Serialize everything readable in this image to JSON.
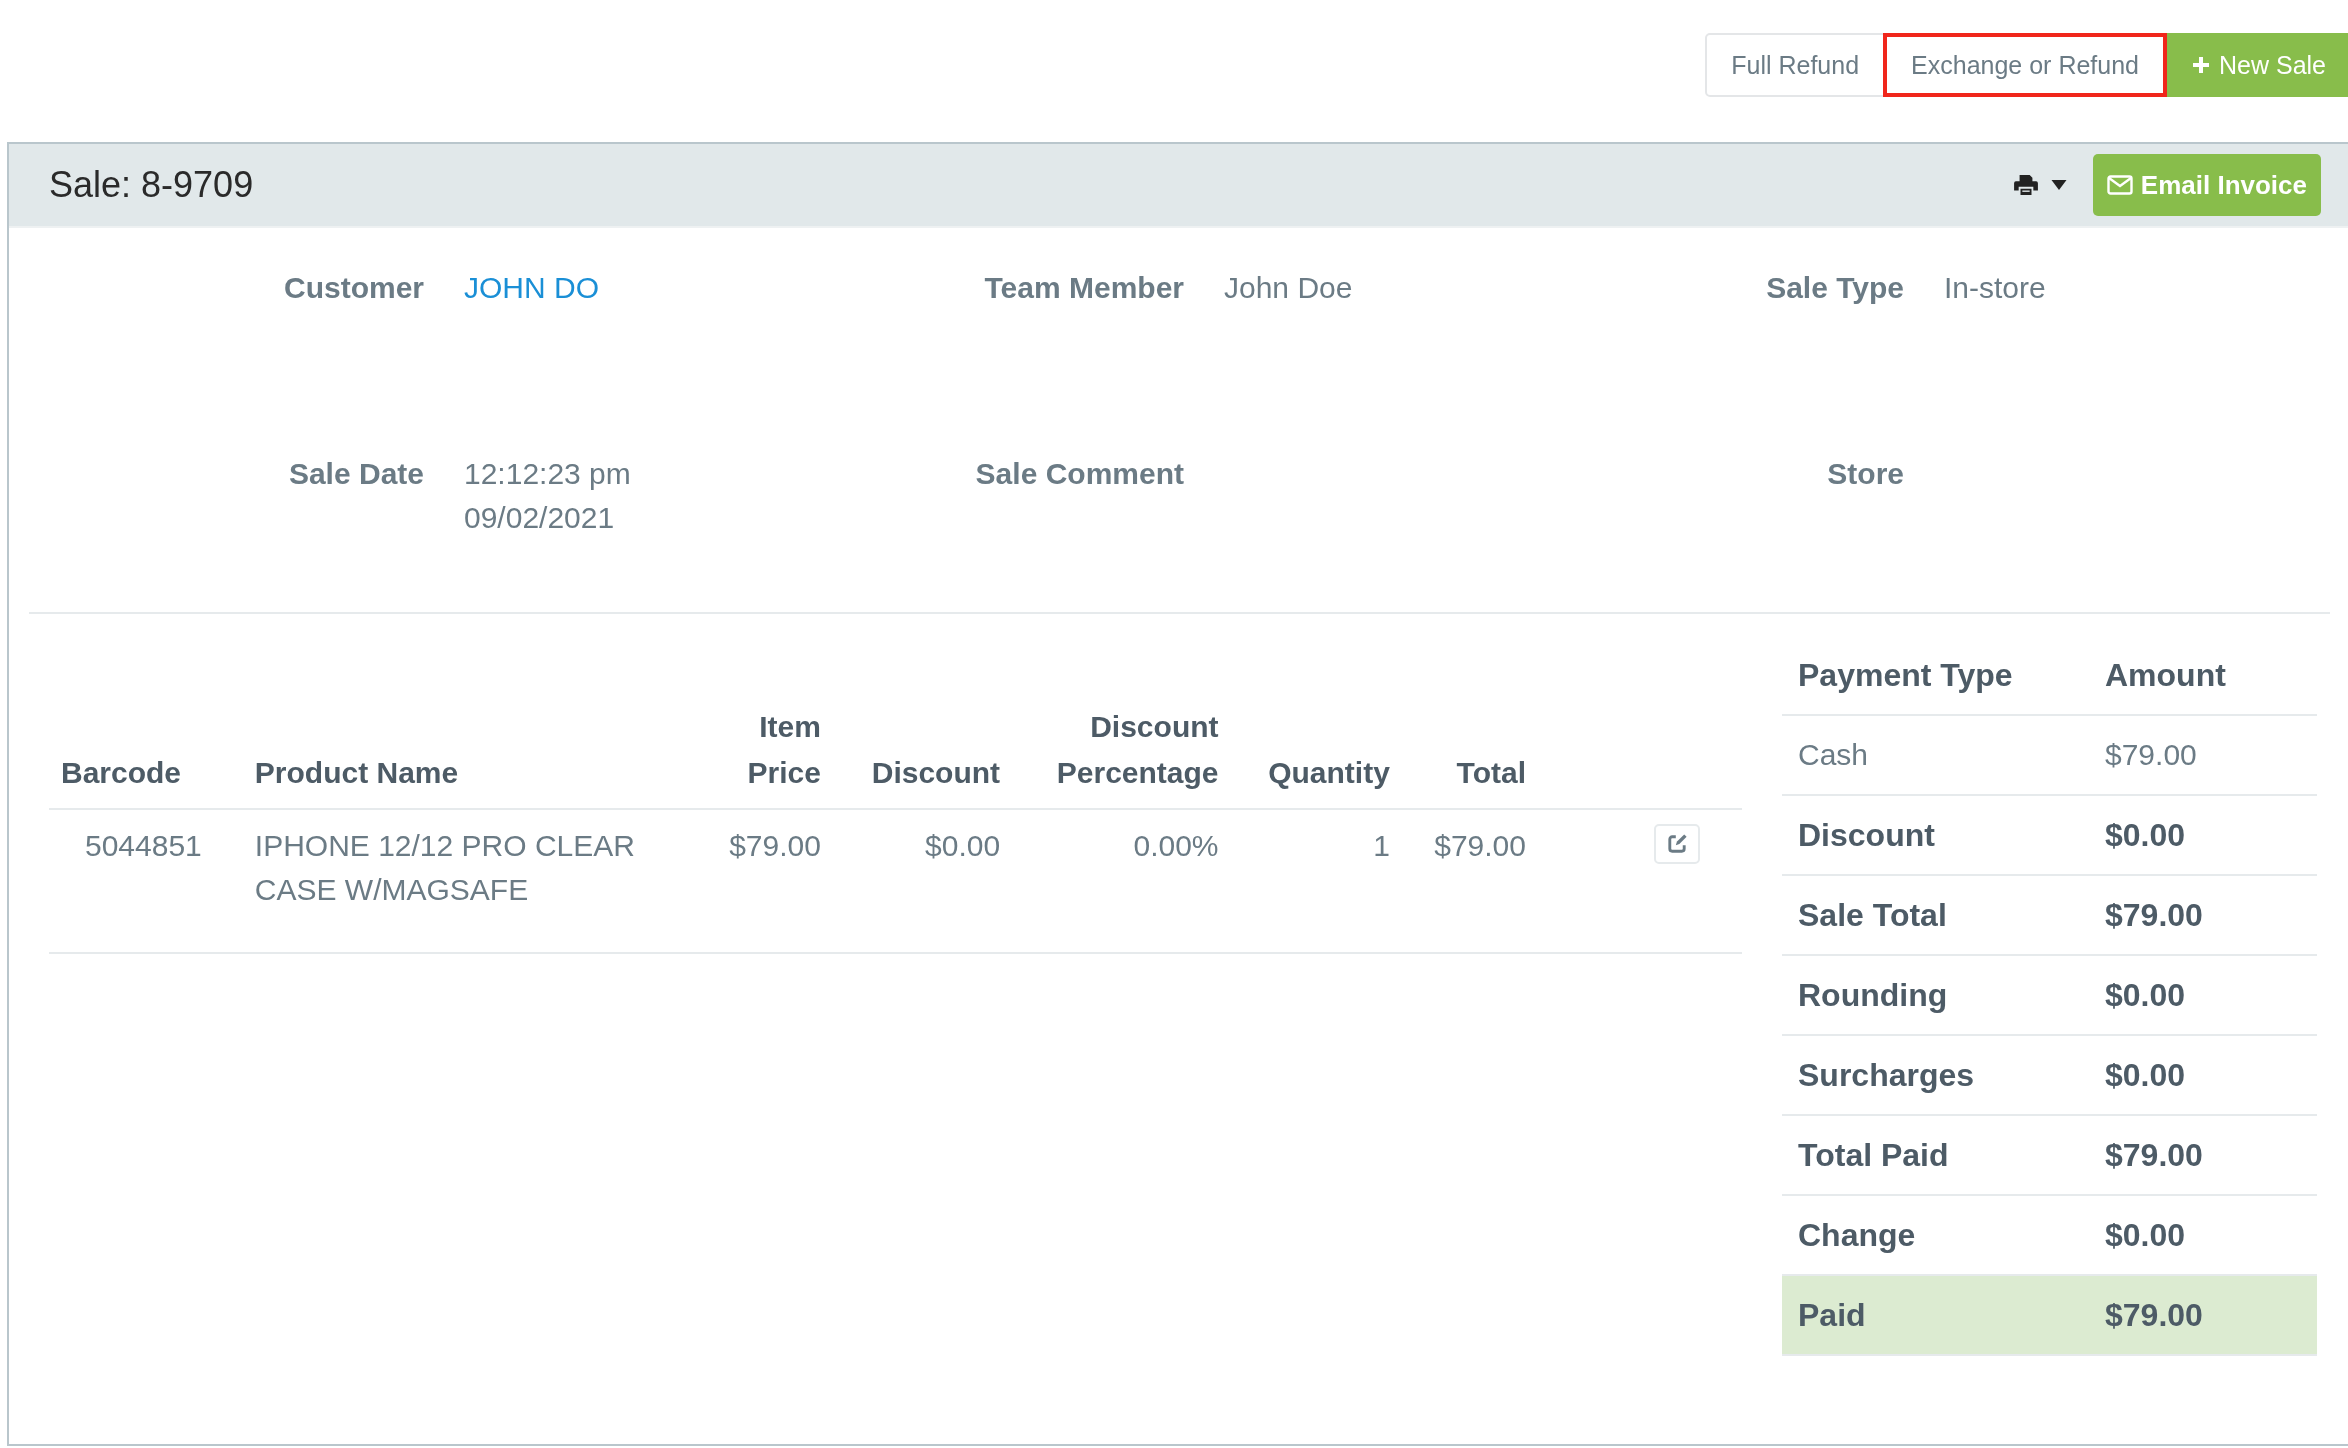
{
  "top_buttons": [
    {
      "label": "Full Refund",
      "kind": "plain",
      "highlighted": false
    },
    {
      "label": "Exchange or Refund",
      "kind": "plain",
      "highlighted": true
    },
    {
      "label": "New Sale",
      "kind": "primary",
      "highlighted": false
    }
  ],
  "sale": {
    "title": "Sale: 8-9709",
    "email_button": "Email Invoice"
  },
  "details": [
    {
      "label": "Customer",
      "value": "JOHN DO",
      "kind": "link"
    },
    {
      "label": "Team Member",
      "value": "John Doe",
      "kind": "text"
    },
    {
      "label": "Sale Type",
      "value": "In-store",
      "kind": "text"
    },
    {
      "label": "Sale Date",
      "value": "12:12:23 pm",
      "value_2": "09/02/2021",
      "kind": "text"
    },
    {
      "label": "Sale Comment"
    },
    {
      "label": "Store"
    }
  ],
  "items_table": {
    "columns": [
      {
        "label": "Barcode"
      },
      {
        "label": "Product Name"
      },
      {
        "label": "Item",
        "label_2": "Price"
      },
      {
        "label": "Discount"
      },
      {
        "label": "Discount",
        "label_2": "Percentage"
      },
      {
        "label": "Quantity"
      },
      {
        "label": "Total"
      }
    ],
    "rows": [
      {
        "cells": [
          "5044851",
          "IPHONE 12/12 PRO CLEAR CASE W/MAGSAFE",
          "$79.00",
          "$0.00",
          "0.00%",
          "1",
          "$79.00"
        ]
      }
    ]
  },
  "payments": {
    "columns": [
      "Payment Type",
      "Amount"
    ],
    "rows": [
      {
        "label": "Cash",
        "amount": "$79.00",
        "kind": "payment"
      },
      {
        "label": "Discount",
        "amount": "$0.00",
        "kind": "summary"
      },
      {
        "label": "Sale Total",
        "amount": "$79.00",
        "kind": "summary"
      },
      {
        "label": "Rounding",
        "amount": "$0.00",
        "kind": "summary"
      },
      {
        "label": "Surcharges",
        "amount": "$0.00",
        "kind": "summary"
      },
      {
        "label": "Total Paid",
        "amount": "$79.00",
        "kind": "summary"
      },
      {
        "label": "Change",
        "amount": "$0.00",
        "kind": "summary"
      },
      {
        "label": "Paid",
        "amount": "$79.00",
        "kind": "status"
      }
    ]
  }
}
